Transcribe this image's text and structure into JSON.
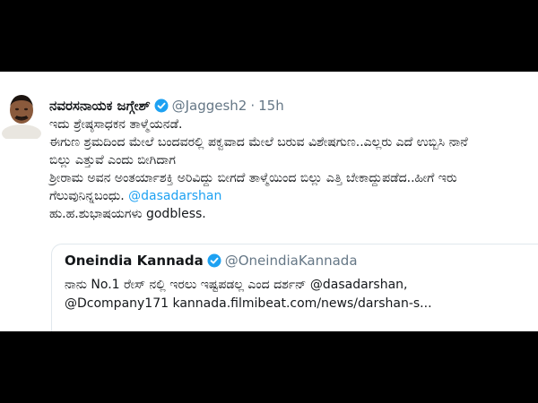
{
  "tweet": {
    "author_name": "ನವರಸನಾಯಕ ಜಗ್ಗೇಶ್",
    "handle": "@Jaggesh2",
    "separator": "·",
    "time": "15h",
    "verified_icon": "verified-badge-icon",
    "lines": [
      "ಇದು ಶ್ರೇಷ್ಠಸಾಧಕನ ತಾಳ್ಮೆಯನಡೆ.",
      "ಈಗುಣ ಶ್ರಮದಿಂದ ಮೇಲೆ ಬಂದವರಲ್ಲಿ ಪಕ್ವವಾದ ಮೇಲೆ ಬರುವ ವಿಶೇಷಗುಣ..ಎಲ್ಲರು ಎದೆ ಉಬ್ಬಿಸಿ ನಾನೆ",
      "ಬಿಲ್ಲು ಎತ್ತುವೆ ಎಂದು ಬೀಗಿದಾಗ",
      "ಶ್ರೀರಾಮ ಅವನ ಅಂತರ್ಯಾಶಕ್ತಿ ಅರಿವಿದ್ದು ಬೀಗದೆ ತಾಳ್ಮೆಯಿಂದ ಬಿಲ್ಲು ಎತ್ತಿ ಬೇಕಾದ್ದುಪಡೆದ..ಹೀಗೆ ಇರು",
      "ಗೆಲುವುನಿನ್ನಬಂಧು.",
      "ಹು.ಹ.ಶುಭಾಷಯಗಳು godbless."
    ],
    "mention": "@dasadarshan"
  },
  "quote": {
    "author_name": "Oneindia Kannada",
    "handle": "@OneindiaKannada",
    "verified_icon": "verified-badge-icon",
    "line1": "ನಾನು No.1 ರೇಸ್ ನಲ್ಲಿ ಇರಲು ಇಷ್ಟಪಡಲ್ಲ ಎಂದ ದರ್ಶನ್ @dasadarshan,",
    "line2": "@Dcompany171 kannada.filmibeat.com/news/darshan-s..."
  },
  "colors": {
    "background": "#000000",
    "card": "#ffffff",
    "link": "#1da1f2",
    "muted": "#657786",
    "text": "#14171a"
  }
}
